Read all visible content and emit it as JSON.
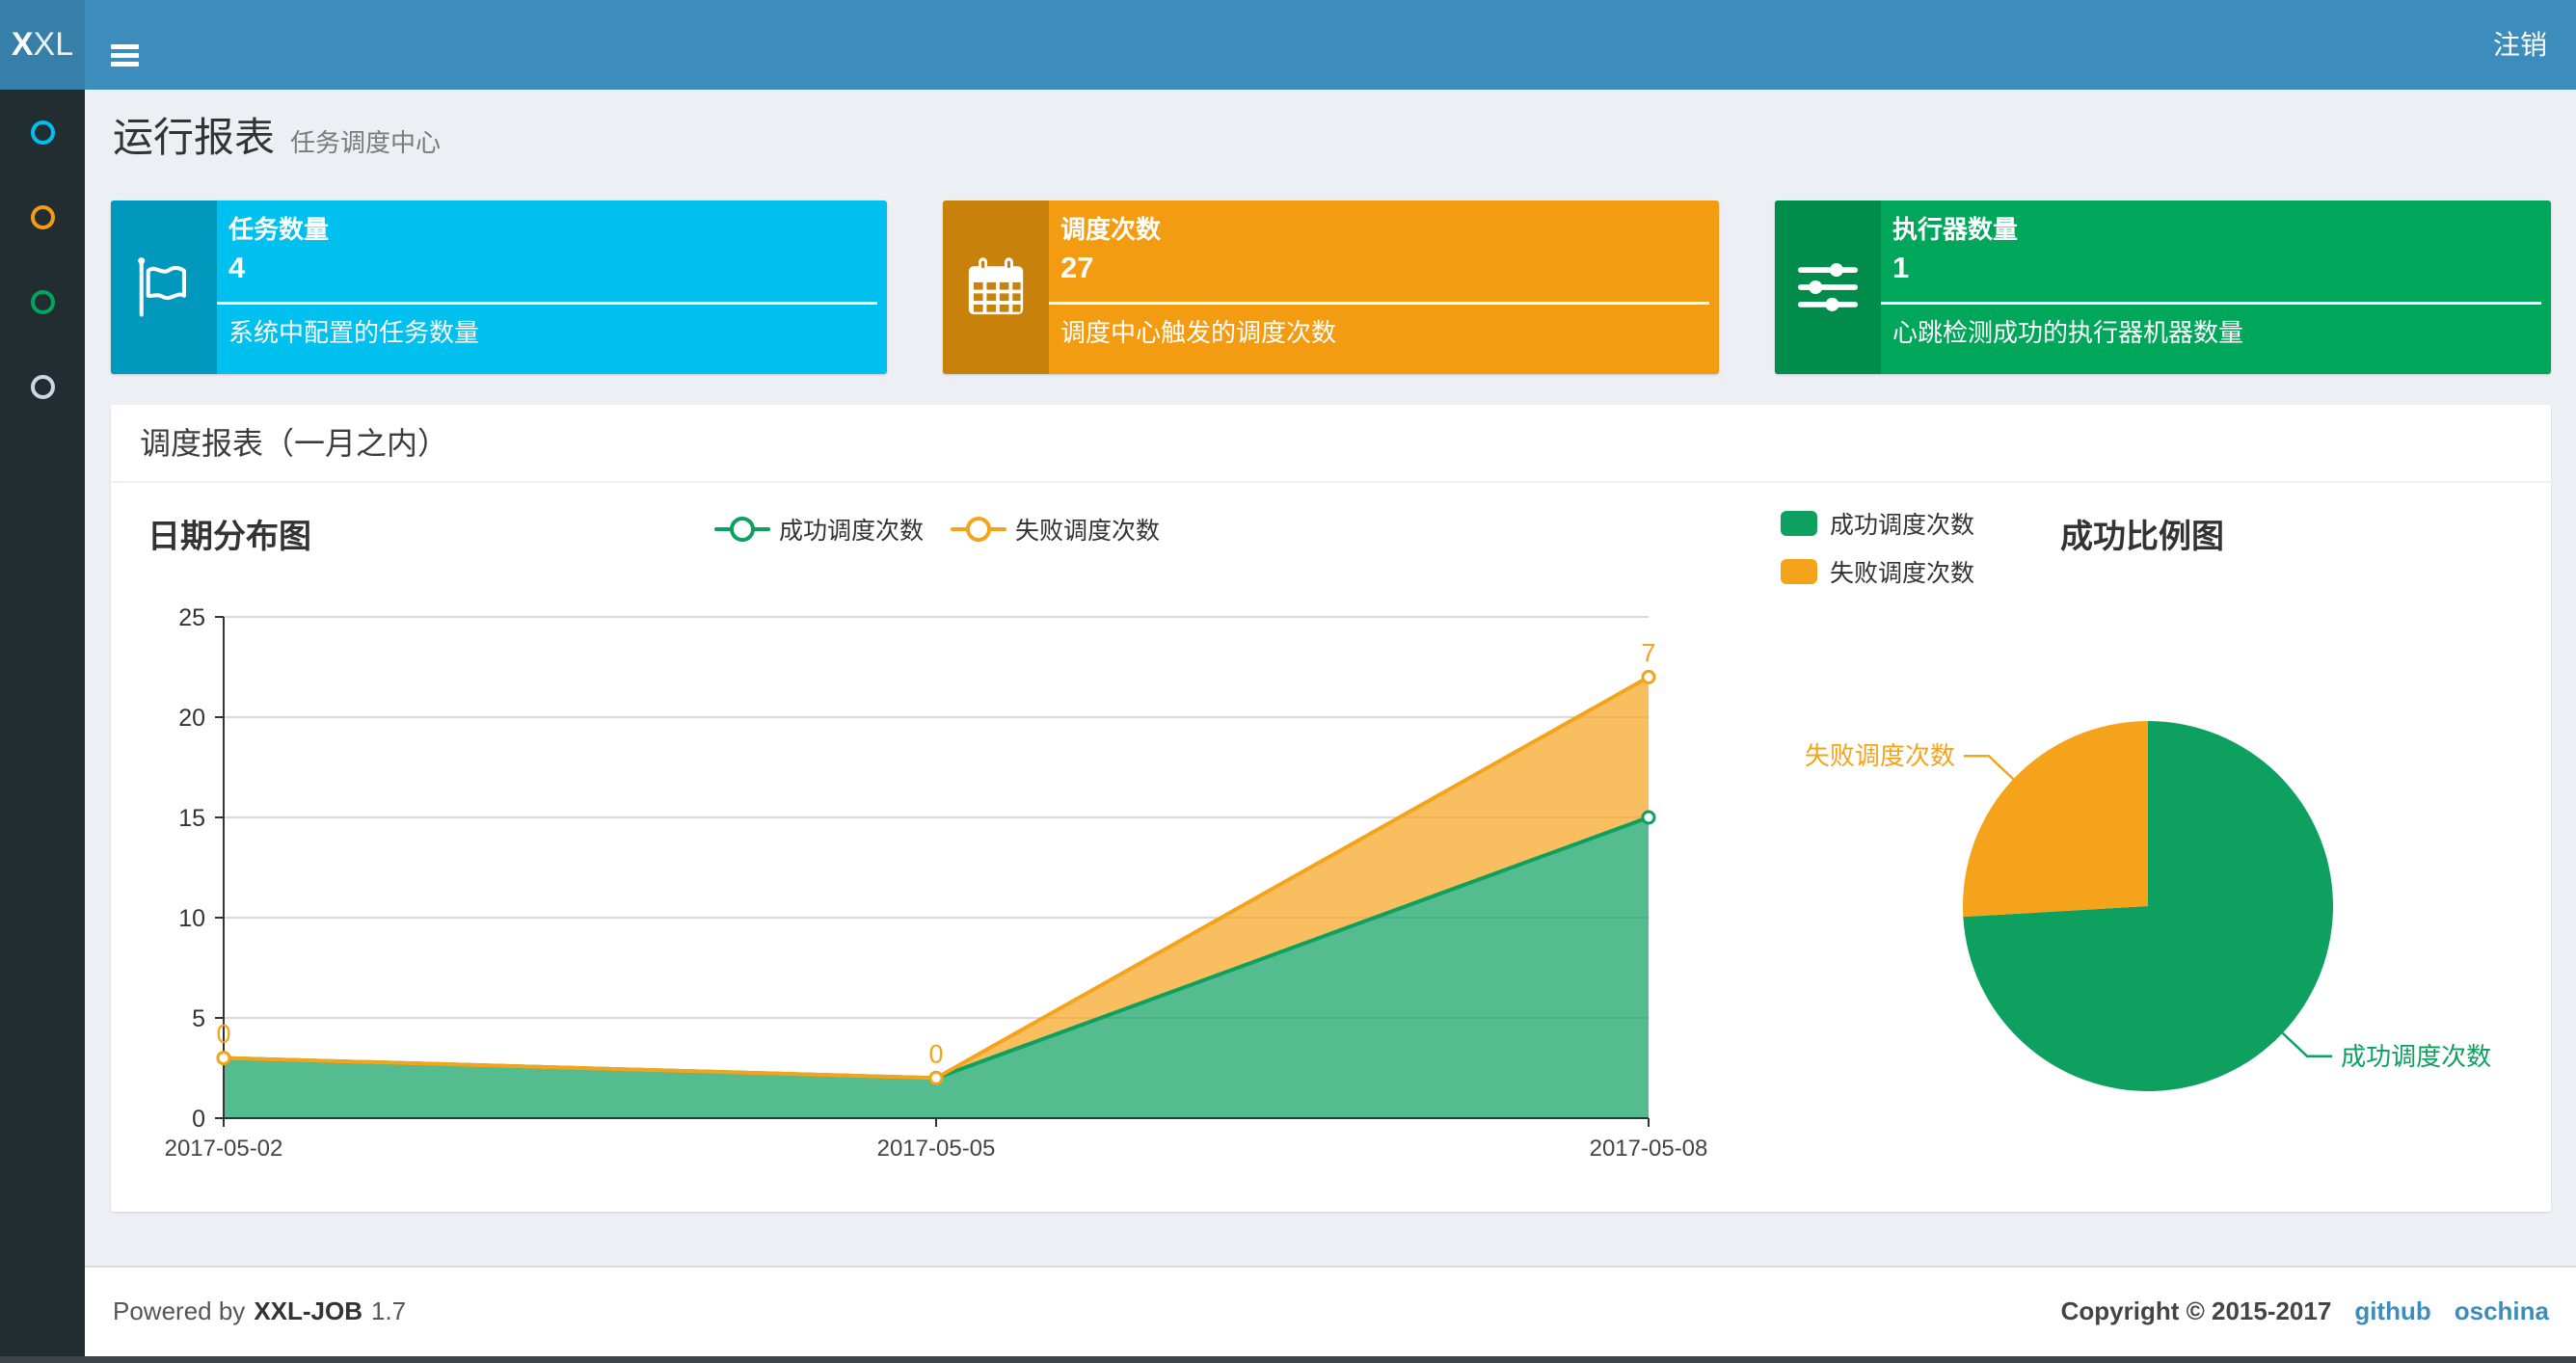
{
  "colors": {
    "navbar": "#3c8dbc",
    "logo_bg": "#367fa9",
    "sidebar_bg": "#222d32",
    "page_bg": "#ecf0f5",
    "link": "#3c8dbc"
  },
  "header": {
    "logo_bold": "X",
    "logo_rest": "XL",
    "logout_label": "注销"
  },
  "sidebar": {
    "items": [
      {
        "icon": "circle-o-icon",
        "color": "#00c0ef"
      },
      {
        "icon": "circle-o-icon",
        "color": "#f39c12"
      },
      {
        "icon": "circle-o-icon",
        "color": "#00a65a"
      },
      {
        "icon": "circle-o-icon",
        "color": "#d2d6de"
      }
    ]
  },
  "page": {
    "title": "运行报表",
    "subtitle": "任务调度中心"
  },
  "cards": [
    {
      "title": "任务数量",
      "value": "4",
      "desc": "系统中配置的任务数量",
      "bg": "#00c0ef",
      "icon_bg": "#0098bd",
      "icon": "flag-icon"
    },
    {
      "title": "调度次数",
      "value": "27",
      "desc": "调度中心触发的调度次数",
      "bg": "#f39c12",
      "icon_bg": "#c8810b",
      "icon": "calendar-icon"
    },
    {
      "title": "执行器数量",
      "value": "1",
      "desc": "心跳检测成功的执行器机器数量",
      "bg": "#00a65a",
      "icon_bg": "#008d4c",
      "icon": "sliders-icon"
    }
  ],
  "panel": {
    "title": "调度报表（一月之内）"
  },
  "chart_data": [
    {
      "type": "area",
      "title": "日期分布图",
      "categories": [
        "2017-05-02",
        "2017-05-05",
        "2017-05-08"
      ],
      "series": [
        {
          "name": "成功调度次数",
          "color": "#0da05f",
          "values": [
            3,
            2,
            15
          ]
        },
        {
          "name": "失败调度次数",
          "color": "#f5a31b",
          "values": [
            0,
            0,
            7
          ]
        }
      ],
      "stacked": true,
      "point_labels_series": "失败调度次数",
      "point_labels": [
        "0",
        "0",
        "7"
      ],
      "ylim": [
        0,
        25
      ],
      "ytick_step": 5,
      "yticks": [
        0,
        5,
        10,
        15,
        20,
        25
      ],
      "grid": true,
      "legend_position": "top-center"
    },
    {
      "type": "pie",
      "title": "成功比例图",
      "slices": [
        {
          "name": "成功调度次数",
          "value": 20,
          "color": "#0da05f"
        },
        {
          "name": "失败调度次数",
          "value": 7,
          "color": "#f5a31b"
        }
      ],
      "start_angle": 90,
      "clockwise": true,
      "legend_position": "top-left"
    }
  ],
  "footer": {
    "powered_prefix": "Powered by",
    "product": "XXL-JOB",
    "version": "1.7",
    "copyright": "Copyright © 2015-2017",
    "links": [
      "github",
      "oschina"
    ]
  }
}
